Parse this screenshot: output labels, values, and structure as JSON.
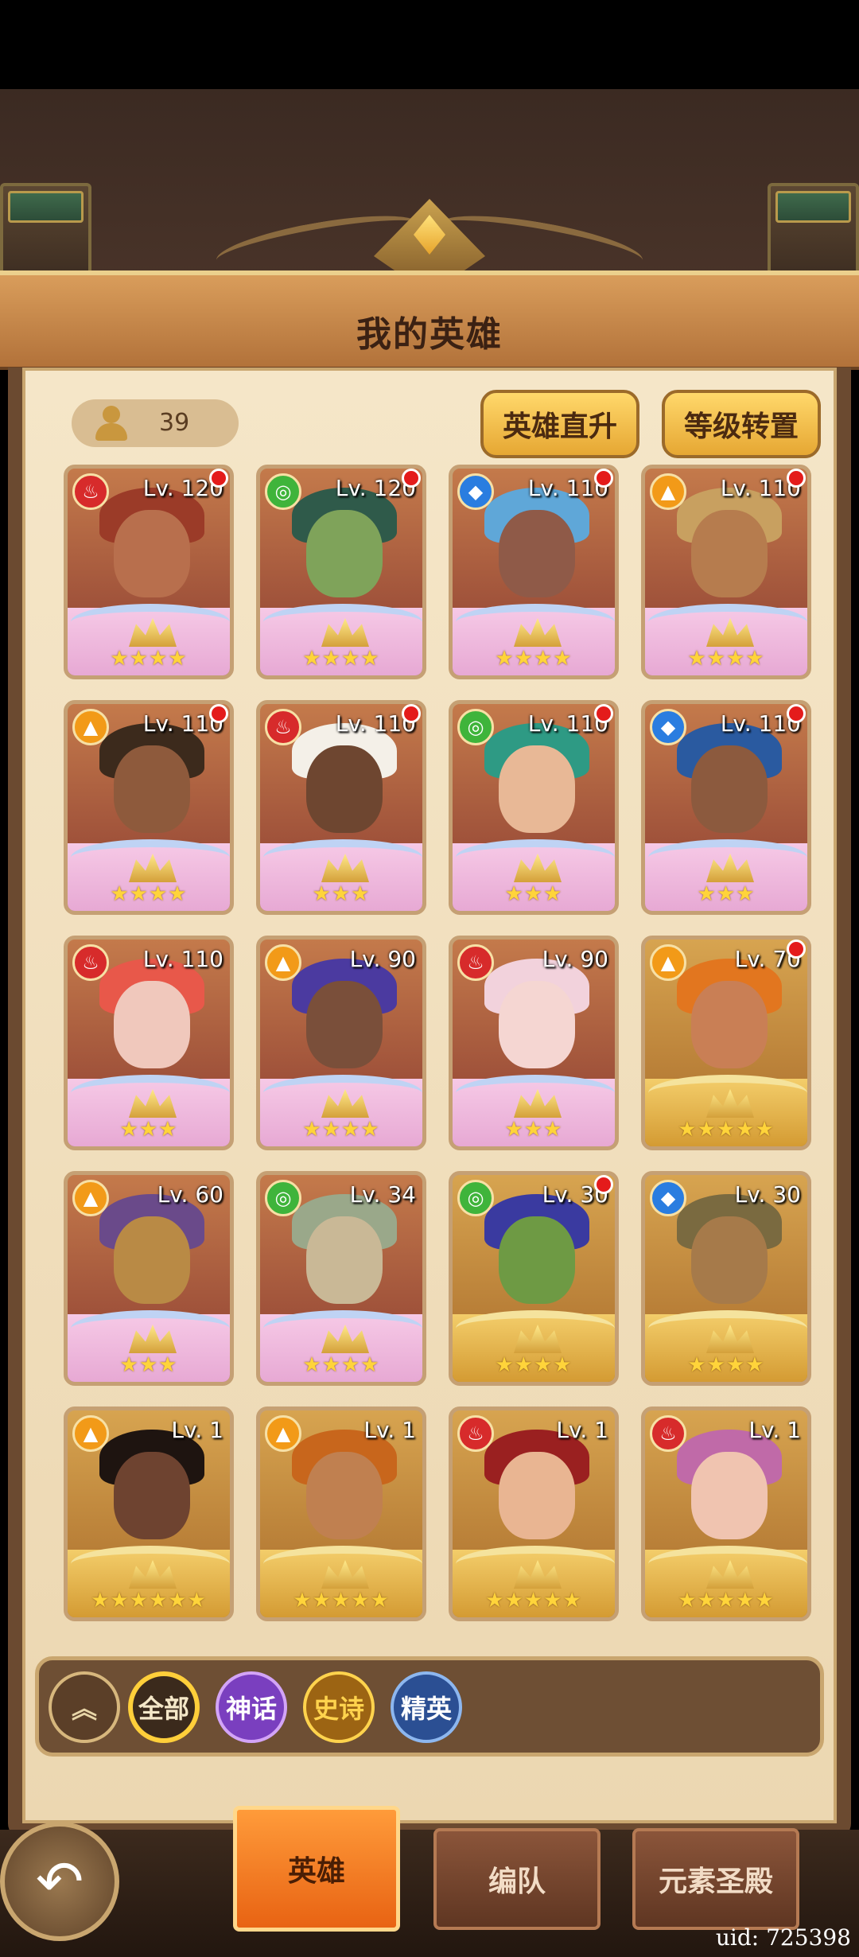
{
  "title": "我的英雄",
  "hero_count": "39",
  "buttons": {
    "level_up": "英雄直升",
    "level_transfer": "等级转置"
  },
  "heroes": [
    {
      "level": "Lv. 120",
      "element": "fire",
      "stars": "★★★★",
      "rarity": "mythic",
      "red_dot": true
    },
    {
      "level": "Lv. 120",
      "element": "wind",
      "stars": "★★★★",
      "rarity": "mythic",
      "red_dot": true
    },
    {
      "level": "Lv. 110",
      "element": "water",
      "stars": "★★★★",
      "rarity": "mythic",
      "red_dot": true
    },
    {
      "level": "Lv. 110",
      "element": "light",
      "stars": "★★★★",
      "rarity": "mythic",
      "red_dot": true
    },
    {
      "level": "Lv. 110",
      "element": "light",
      "stars": "★★★★",
      "rarity": "mythic",
      "red_dot": true
    },
    {
      "level": "Lv. 110",
      "element": "fire",
      "stars": "★★★",
      "rarity": "mythic",
      "red_dot": true
    },
    {
      "level": "Lv. 110",
      "element": "wind",
      "stars": "★★★",
      "rarity": "mythic",
      "red_dot": true
    },
    {
      "level": "Lv. 110",
      "element": "water",
      "stars": "★★★",
      "rarity": "mythic",
      "red_dot": true
    },
    {
      "level": "Lv. 110",
      "element": "fire",
      "stars": "★★★",
      "rarity": "mythic",
      "red_dot": false
    },
    {
      "level": "Lv. 90",
      "element": "light",
      "stars": "★★★★",
      "rarity": "mythic",
      "red_dot": false
    },
    {
      "level": "Lv. 90",
      "element": "fire",
      "stars": "★★★",
      "rarity": "mythic",
      "red_dot": false
    },
    {
      "level": "Lv. 70",
      "element": "light",
      "stars": "★★★★★",
      "rarity": "legend",
      "red_dot": true
    },
    {
      "level": "Lv. 60",
      "element": "light",
      "stars": "★★★",
      "rarity": "mythic",
      "red_dot": false
    },
    {
      "level": "Lv. 34",
      "element": "wind",
      "stars": "★★★★",
      "rarity": "mythic",
      "red_dot": false
    },
    {
      "level": "Lv. 30",
      "element": "wind",
      "stars": "★★★★",
      "rarity": "legend",
      "red_dot": true
    },
    {
      "level": "Lv. 30",
      "element": "water",
      "stars": "★★★★",
      "rarity": "legend",
      "red_dot": false
    },
    {
      "level": "Lv. 1",
      "element": "light",
      "stars": "★★★★★★",
      "rarity": "legend",
      "red_dot": false
    },
    {
      "level": "Lv. 1",
      "element": "light",
      "stars": "★★★★★",
      "rarity": "legend",
      "red_dot": false
    },
    {
      "level": "Lv. 1",
      "element": "fire",
      "stars": "★★★★★",
      "rarity": "legend",
      "red_dot": false
    },
    {
      "level": "Lv. 1",
      "element": "fire",
      "stars": "★★★★★",
      "rarity": "legend",
      "red_dot": false
    }
  ],
  "filters": {
    "all": "全部",
    "myth": "神话",
    "epic": "史诗",
    "elite": "精英"
  },
  "tabs": {
    "hero": "英雄",
    "team": "编队",
    "shrine": "元素圣殿"
  },
  "uid": "uid: 725398",
  "colors": {
    "fire": "#d72b2b",
    "wind": "#3fb43b",
    "water": "#2a7de0",
    "light": "#f29a18"
  }
}
